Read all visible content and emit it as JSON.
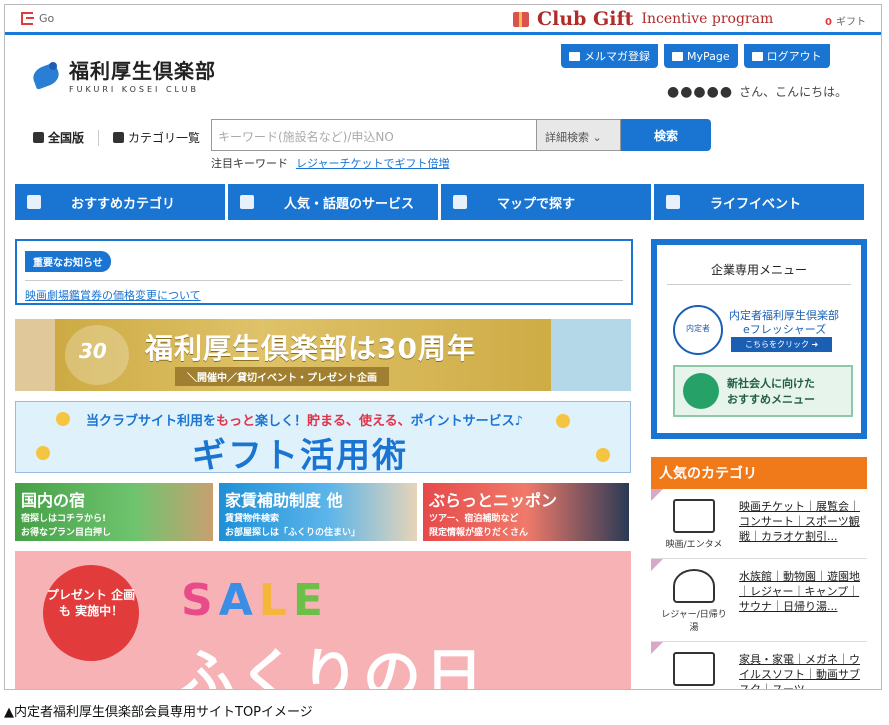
{
  "topbar": {
    "go": "Go",
    "brand": "Club Gift",
    "brand_sub": "Incentive program",
    "gift_count": "0",
    "gift_label": "ギフト"
  },
  "logo": {
    "title": "福利厚生倶楽部",
    "sub": "FUKURI KOSEI CLUB"
  },
  "top_buttons": [
    "メルマガ登録",
    "MyPage",
    "ログアウト"
  ],
  "greeting": {
    "name": "●●●●●",
    "text": "さん、こんにちは。"
  },
  "scope": {
    "national": "全国版",
    "category": "カテゴリ一覧"
  },
  "search": {
    "placeholder": "キーワード(施設名など)/申込NO",
    "advanced": "詳細検索",
    "button": "検索"
  },
  "hot_keyword": {
    "label": "注目キーワード",
    "link": "レジャーチケットでギフト倍増"
  },
  "nav": [
    "おすすめカテゴリ",
    "人気・話題のサービス",
    "マップで探す",
    "ライフイベント"
  ],
  "notice": {
    "tag": "重要なお知らせ",
    "link": "映画劇場鑑賞券の価格変更について"
  },
  "banner30": {
    "badge": "30",
    "title": "福利厚生倶楽部は30周年",
    "sub": "＼開催中／貸切イベント・プレゼント企画"
  },
  "banner_gift": {
    "sub_a": "当クラブサイト利用を",
    "sub_b": "もっと",
    "sub_c": "楽しく！",
    "sub_d": "貯まる、使える、",
    "sub_e": "ポイントサービス♪",
    "title": "ギフト活用術"
  },
  "row3": [
    {
      "title": "国内の宿",
      "sub1": "宿探しはコチラから!",
      "sub2": "お得なプラン目白押し"
    },
    {
      "title": "家賃補助制度 他",
      "sub1": "賃貸物件検索",
      "sub2": "お部屋探しは「ふくりの住まい」"
    },
    {
      "title": "ぶらっとニッポン",
      "sub1": "ツアー、宿泊補助など",
      "sub2": "限定情報が盛りだくさん"
    }
  ],
  "sale": {
    "badge": "プレゼント 企画も 実施中！",
    "word": "SALE",
    "title": "ふくりの日",
    "letter_colors": [
      "#e84a8a",
      "#3a8ee6",
      "#f5b73b",
      "#6cc04a"
    ]
  },
  "side_menu": {
    "title": "企業専用メニュー",
    "ef_emblem": "内定者",
    "ef_line1": "内定者福利厚生倶楽部",
    "ef_line2": "eフレッシャーズ",
    "ef_btn": "こちらをクリック ➜",
    "new_line1": "新社会人に向けた",
    "new_line2": "おすすめメニュー"
  },
  "popular": {
    "title": "人気のカテゴリ",
    "items": [
      {
        "icon": "映画/エンタメ",
        "links": "映画チケット｜展覧会｜コンサート｜スポーツ観戦｜カラオケ割引..."
      },
      {
        "icon": "レジャー/日帰り湯",
        "links": "水族館｜動物園｜遊園地｜レジャー｜キャンプ｜サウナ｜日帰り湯..."
      },
      {
        "icon": "",
        "links": "家具・家電｜メガネ｜ウイルスソフト｜動画サブスク｜スーツ..."
      }
    ]
  },
  "caption": "▲内定者福利厚生倶楽部会員専用サイトTOPイメージ"
}
